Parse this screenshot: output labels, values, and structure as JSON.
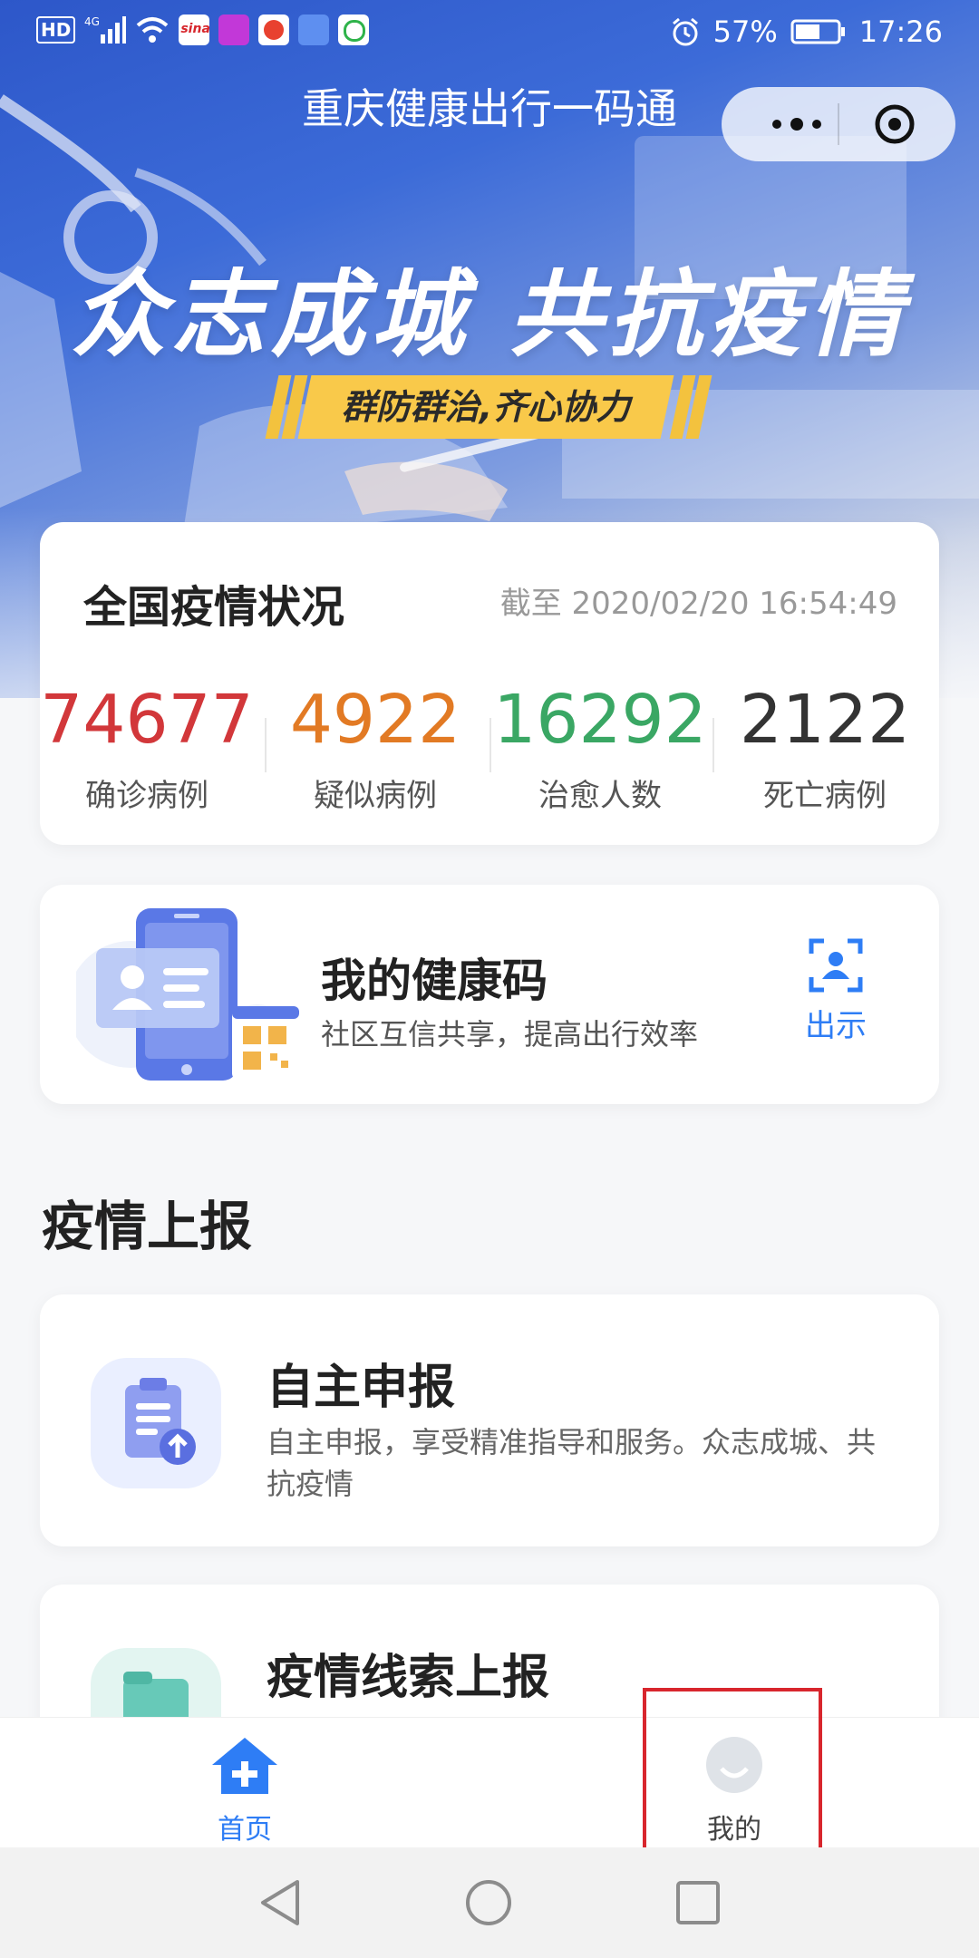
{
  "status_bar": {
    "left_icons": [
      "hd-icon",
      "4g-signal-icon",
      "wifi-icon",
      "sina-app-icon",
      "video-app-icon",
      "weibo-app-icon",
      "music-app-icon",
      "browser-app-icon"
    ],
    "battery": "57%",
    "time": "17:26"
  },
  "header": {
    "title": "重庆健康出行一码通",
    "slogan": "众志成城 共抗疫情",
    "sub_slogan": "群防群治,齐心协力"
  },
  "stats": {
    "title": "全国疫情状况",
    "as_of": "截至 2020/02/20 16:54:49",
    "items": [
      {
        "value": "74677",
        "label": "确诊病例",
        "color": "#d2373a"
      },
      {
        "value": "4922",
        "label": "疑似病例",
        "color": "#e27a24"
      },
      {
        "value": "16292",
        "label": "治愈人数",
        "color": "#3aa764"
      },
      {
        "value": "2122",
        "label": "死亡病例",
        "color": "#333333"
      }
    ]
  },
  "health_code": {
    "title": "我的健康码",
    "desc": "社区互信共享，提高出行效率",
    "show_label": "出示"
  },
  "report_section": {
    "title": "疫情上报",
    "items": [
      {
        "title": "自主申报",
        "desc": "自主申报，享受精准指导和服务。众志成城、共抗疫情"
      },
      {
        "title": "疫情线索上报",
        "desc": ""
      }
    ]
  },
  "tabbar": {
    "home_label": "首页",
    "me_label": "我的"
  },
  "colors": {
    "accent": "#2e7df5",
    "highlight": "#d8262d"
  }
}
